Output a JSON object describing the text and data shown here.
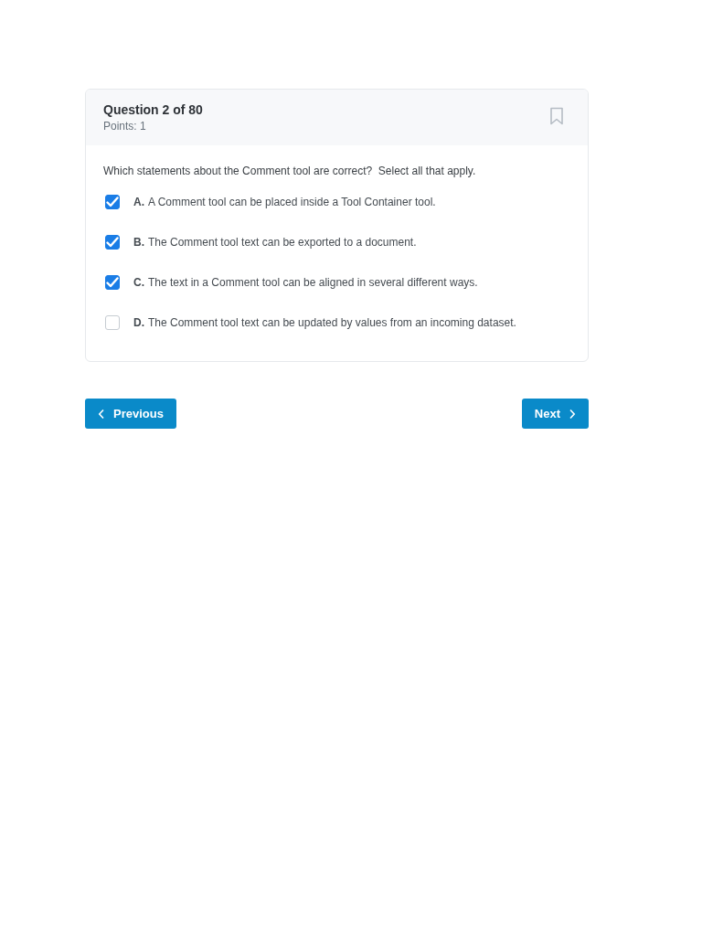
{
  "question": {
    "title": "Question 2 of 80",
    "points": "Points: 1",
    "prompt": "Which statements about the Comment tool are correct?  Select all that apply.",
    "options": [
      {
        "letter": "A.",
        "text": "A Comment tool can be placed inside a Tool Container tool.",
        "checked": true
      },
      {
        "letter": "B.",
        "text": "The Comment tool text can be exported to a document.",
        "checked": true
      },
      {
        "letter": "C.",
        "text": "The text in a Comment tool can be aligned in several different ways.",
        "checked": true
      },
      {
        "letter": "D.",
        "text": "The Comment tool text can be updated by values from an incoming dataset.",
        "checked": false
      }
    ]
  },
  "navigation": {
    "previous": "Previous",
    "next": "Next"
  }
}
